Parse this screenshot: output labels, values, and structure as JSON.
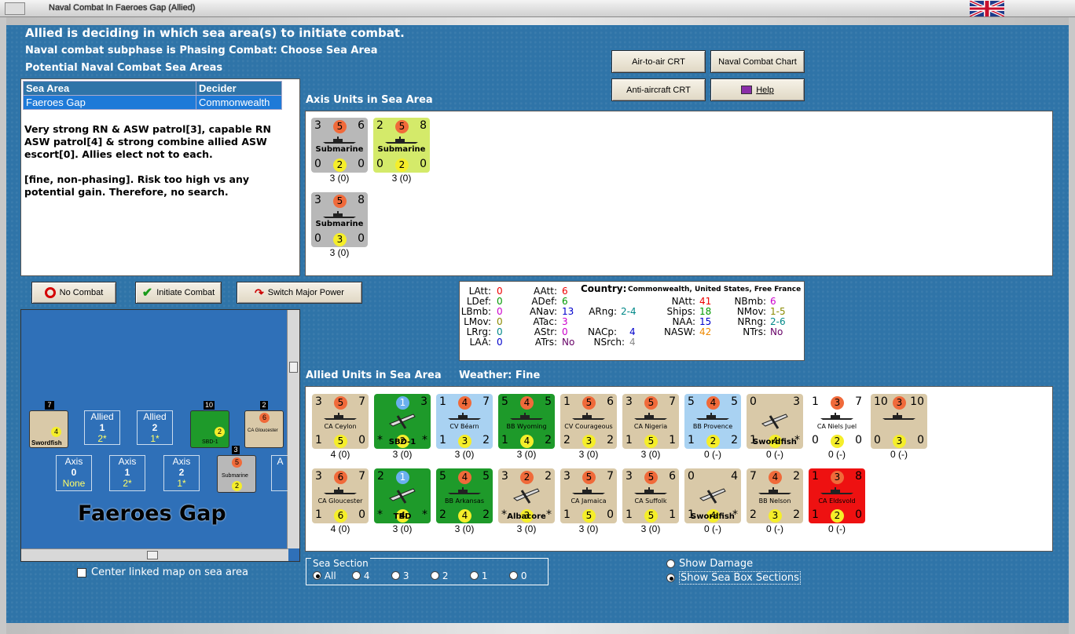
{
  "window": {
    "title": "Naval Combat In Faeroes Gap (Allied)"
  },
  "header": {
    "line1": "Allied is deciding in which sea area(s) to initiate combat.",
    "line2": "Naval combat subphase is Phasing Combat: Choose Sea Area",
    "line3": "Potential Naval Combat Sea Areas"
  },
  "sea_table": {
    "col1": "Sea Area",
    "col2": "Decider",
    "row_area": "Faeroes Gap",
    "row_decider": "Commonwealth"
  },
  "notes": {
    "p1": "Very strong RN & ASW patrol[3], capable RN ASW patrol[4] & strong combine allied ASW escort[0]. Allies elect not to each.",
    "p2": "[fine, non-phasing].  Risk too high vs any potential gain.  Therefore, no search."
  },
  "buttons": {
    "air_crt": "Air-to-air CRT",
    "naval_chart": "Naval Combat Chart",
    "aa_crt": "Anti-aircraft CRT",
    "help": "Help",
    "no_combat": "No Combat",
    "initiate": "Initiate Combat",
    "switch": "Switch Major Power"
  },
  "axis_title": "Axis Units in Sea Area",
  "allied_title": "Allied Units in Sea Area",
  "weather_label": "Weather:  Fine",
  "axis_units": [
    {
      "name": "Submarine",
      "tl": "3",
      "tm": "5",
      "tr": "6",
      "bl": "0",
      "bm": "2",
      "br": "0",
      "sub": "3 (0)",
      "bg": "grey"
    },
    {
      "name": "Submarine",
      "tl": "2",
      "tm": "5",
      "tr": "8",
      "bl": "0",
      "bm": "2",
      "br": "0",
      "sub": "3 (0)",
      "bg": "lime"
    },
    {
      "name": "Submarine",
      "tl": "3",
      "tm": "5",
      "tr": "8",
      "bl": "0",
      "bm": "3",
      "br": "0",
      "sub": "3 (0)",
      "bg": "grey"
    }
  ],
  "allied_units": [
    {
      "name": "CA Ceylon",
      "tl": "3",
      "tm": "5",
      "tr": "7",
      "bl": "1",
      "bm": "5",
      "br": "0",
      "sub": "4 (0)",
      "bg": "tanC",
      "tmc": "orange"
    },
    {
      "name": "SBD-1",
      "tl": "",
      "tm": "1",
      "tr": "3",
      "bl": "*",
      "bm": "2",
      "br": "*",
      "sub": "3 (0)",
      "bg": "green",
      "tmc": "blue",
      "air": true
    },
    {
      "name": "CV Béarn",
      "tl": "1",
      "tm": "4",
      "tr": "7",
      "bl": "1",
      "bm": "3",
      "br": "2",
      "sub": "3 (0)",
      "bg": "lightblue",
      "tmc": "orange"
    },
    {
      "name": "BB Wyoming",
      "tl": "5",
      "tm": "4",
      "tr": "5",
      "bl": "1",
      "bm": "4",
      "br": "2",
      "sub": "3 (0)",
      "bg": "green",
      "tmc": "orange"
    },
    {
      "name": "CV Courageous",
      "tl": "1",
      "tm": "5",
      "tr": "6",
      "bl": "2",
      "bm": "3",
      "br": "2",
      "sub": "3 (0)",
      "bg": "tanC",
      "tmc": "orange"
    },
    {
      "name": "CA Nigeria",
      "tl": "3",
      "tm": "5",
      "tr": "7",
      "bl": "1",
      "bm": "5",
      "br": "1",
      "sub": "3 (0)",
      "bg": "tanC",
      "tmc": "orange"
    },
    {
      "name": "BB Provence",
      "tl": "5",
      "tm": "4",
      "tr": "5",
      "bl": "1",
      "bm": "2",
      "br": "2",
      "sub": "0 (-)",
      "bg": "lightblue",
      "tmc": "orange"
    },
    {
      "name": "Swordfish",
      "tl": "0",
      "tm": "",
      "tr": "3",
      "bl": "1",
      "bm": "4",
      "br": "*",
      "sub": "0 (-)",
      "bg": "tanC",
      "tmc": "orange",
      "air": true
    },
    {
      "name": "CA Niels Juel",
      "tl": "1",
      "tm": "3",
      "tr": "7",
      "bl": "0",
      "bm": "2",
      "br": "0",
      "sub": "0 (-)",
      "bg": "white",
      "tmc": "orange"
    },
    {
      "name": "",
      "tl": "10",
      "tm": "3",
      "tr": "10",
      "bl": "0",
      "bm": "3",
      "br": "0",
      "sub": "0 (-)",
      "bg": "tanC",
      "tmc": "orange"
    },
    {
      "name": "CA Gloucester",
      "tl": "3",
      "tm": "6",
      "tr": "7",
      "bl": "1",
      "bm": "6",
      "br": "0",
      "sub": "4 (0)",
      "bg": "tanC",
      "tmc": "orange"
    },
    {
      "name": "TBD",
      "tl": "2",
      "tm": "1",
      "tr": "",
      "bl": "*",
      "bm": "4",
      "br": "*",
      "sub": "3 (0)",
      "bg": "green",
      "tmc": "blue",
      "air": true
    },
    {
      "name": "BB Arkansas",
      "tl": "5",
      "tm": "4",
      "tr": "5",
      "bl": "2",
      "bm": "4",
      "br": "2",
      "sub": "3 (0)",
      "bg": "green",
      "tmc": "orange"
    },
    {
      "name": "Albacore",
      "tl": "3",
      "tm": "2",
      "tr": "2",
      "bl": "*",
      "bm": "3",
      "br": "*",
      "sub": "3 (0)",
      "bg": "tanC",
      "tmc": "orange",
      "air": true
    },
    {
      "name": "CA Jamaica",
      "tl": "3",
      "tm": "5",
      "tr": "7",
      "bl": "1",
      "bm": "5",
      "br": "0",
      "sub": "3 (0)",
      "bg": "tanC",
      "tmc": "orange"
    },
    {
      "name": "CA Suffolk",
      "tl": "3",
      "tm": "5",
      "tr": "6",
      "bl": "1",
      "bm": "5",
      "br": "1",
      "sub": "3 (0)",
      "bg": "tanC",
      "tmc": "orange"
    },
    {
      "name": "Swordfish",
      "tl": "0",
      "tm": "",
      "tr": "4",
      "bl": "1",
      "bm": "4",
      "br": "*",
      "sub": "0 (-)",
      "bg": "tanC",
      "tmc": "orange",
      "air": true
    },
    {
      "name": "BB Nelson",
      "tl": "7",
      "tm": "4",
      "tr": "2",
      "bl": "2",
      "bm": "3",
      "br": "2",
      "sub": "0 (-)",
      "bg": "tanC",
      "tmc": "orange"
    },
    {
      "name": "CA Eldsvold",
      "tl": "1",
      "tm": "3",
      "tr": "8",
      "bl": "1",
      "bm": "2",
      "br": "0",
      "sub": "0 (-)",
      "bg": "red",
      "tmc": "orange"
    }
  ],
  "stats": {
    "country_label": "Country:",
    "country_value": "Commonwealth, United States, Free France",
    "LAtt": "0",
    "LDef": "0",
    "LBmb": "0",
    "LMov": "0",
    "LRrg": "0",
    "LAA": "0",
    "AAtt": "6",
    "ADef": "6",
    "ANav": "13",
    "ATac": "3",
    "AStr": "0",
    "ATrs": "No",
    "ARng": "2-4",
    "NACp": "4",
    "NSrch": "4",
    "NAtt": "41",
    "Ships": "18",
    "NAA": "15",
    "NASW": "42",
    "NBmb": "6",
    "NMov": "1-5",
    "NRng": "2-6",
    "NTrs": "No"
  },
  "map": {
    "title": "Faeroes Gap",
    "allied1": {
      "label": "Allied",
      "num": "1",
      "val": "2*"
    },
    "allied2": {
      "label": "Allied",
      "num": "2",
      "val": "1*"
    },
    "axis0": {
      "label": "Axis",
      "num": "0",
      "val": "None"
    },
    "axis1": {
      "label": "Axis",
      "num": "1",
      "val": "2*"
    },
    "axis2": {
      "label": "Axis",
      "num": "2",
      "val": "1*"
    },
    "axis3": {
      "label": "A"
    },
    "swordfish_label": "Swordfish",
    "sbd_label": "SBD-1",
    "gloucester_label": "CA Gloucester",
    "sub_label": "Submarine",
    "stack7": "7",
    "stack10": "10",
    "stack2": "2",
    "stack3": "3"
  },
  "center_map": "Center linked map on sea area",
  "sea_section": {
    "legend": "Sea Section",
    "opts": [
      "All",
      "4",
      "3",
      "2",
      "1",
      "0"
    ]
  },
  "show_damage": "Show Damage",
  "show_sections": "Show Sea Box Sections"
}
